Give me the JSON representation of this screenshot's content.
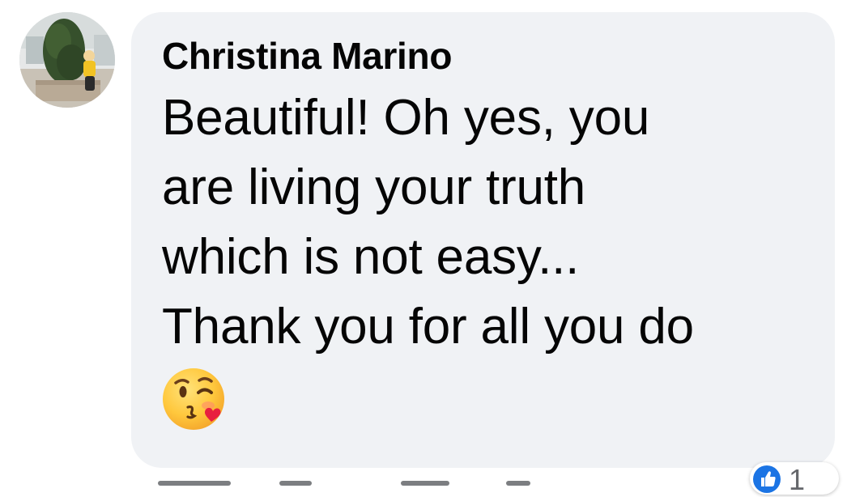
{
  "comment": {
    "author": "Christina Marino",
    "text_lines": [
      "Beautiful! Oh yes, you",
      "are living your truth",
      "which is not easy...",
      "Thank you for all you do"
    ],
    "emoji": "kissing-face-with-heart-emoji"
  },
  "reactions": {
    "icon": "like-icon",
    "count": "1"
  },
  "colors": {
    "bubble": "#f0f2f5",
    "text": "#050505",
    "secondary": "#65676b",
    "like_blue": "#1b74e4"
  }
}
